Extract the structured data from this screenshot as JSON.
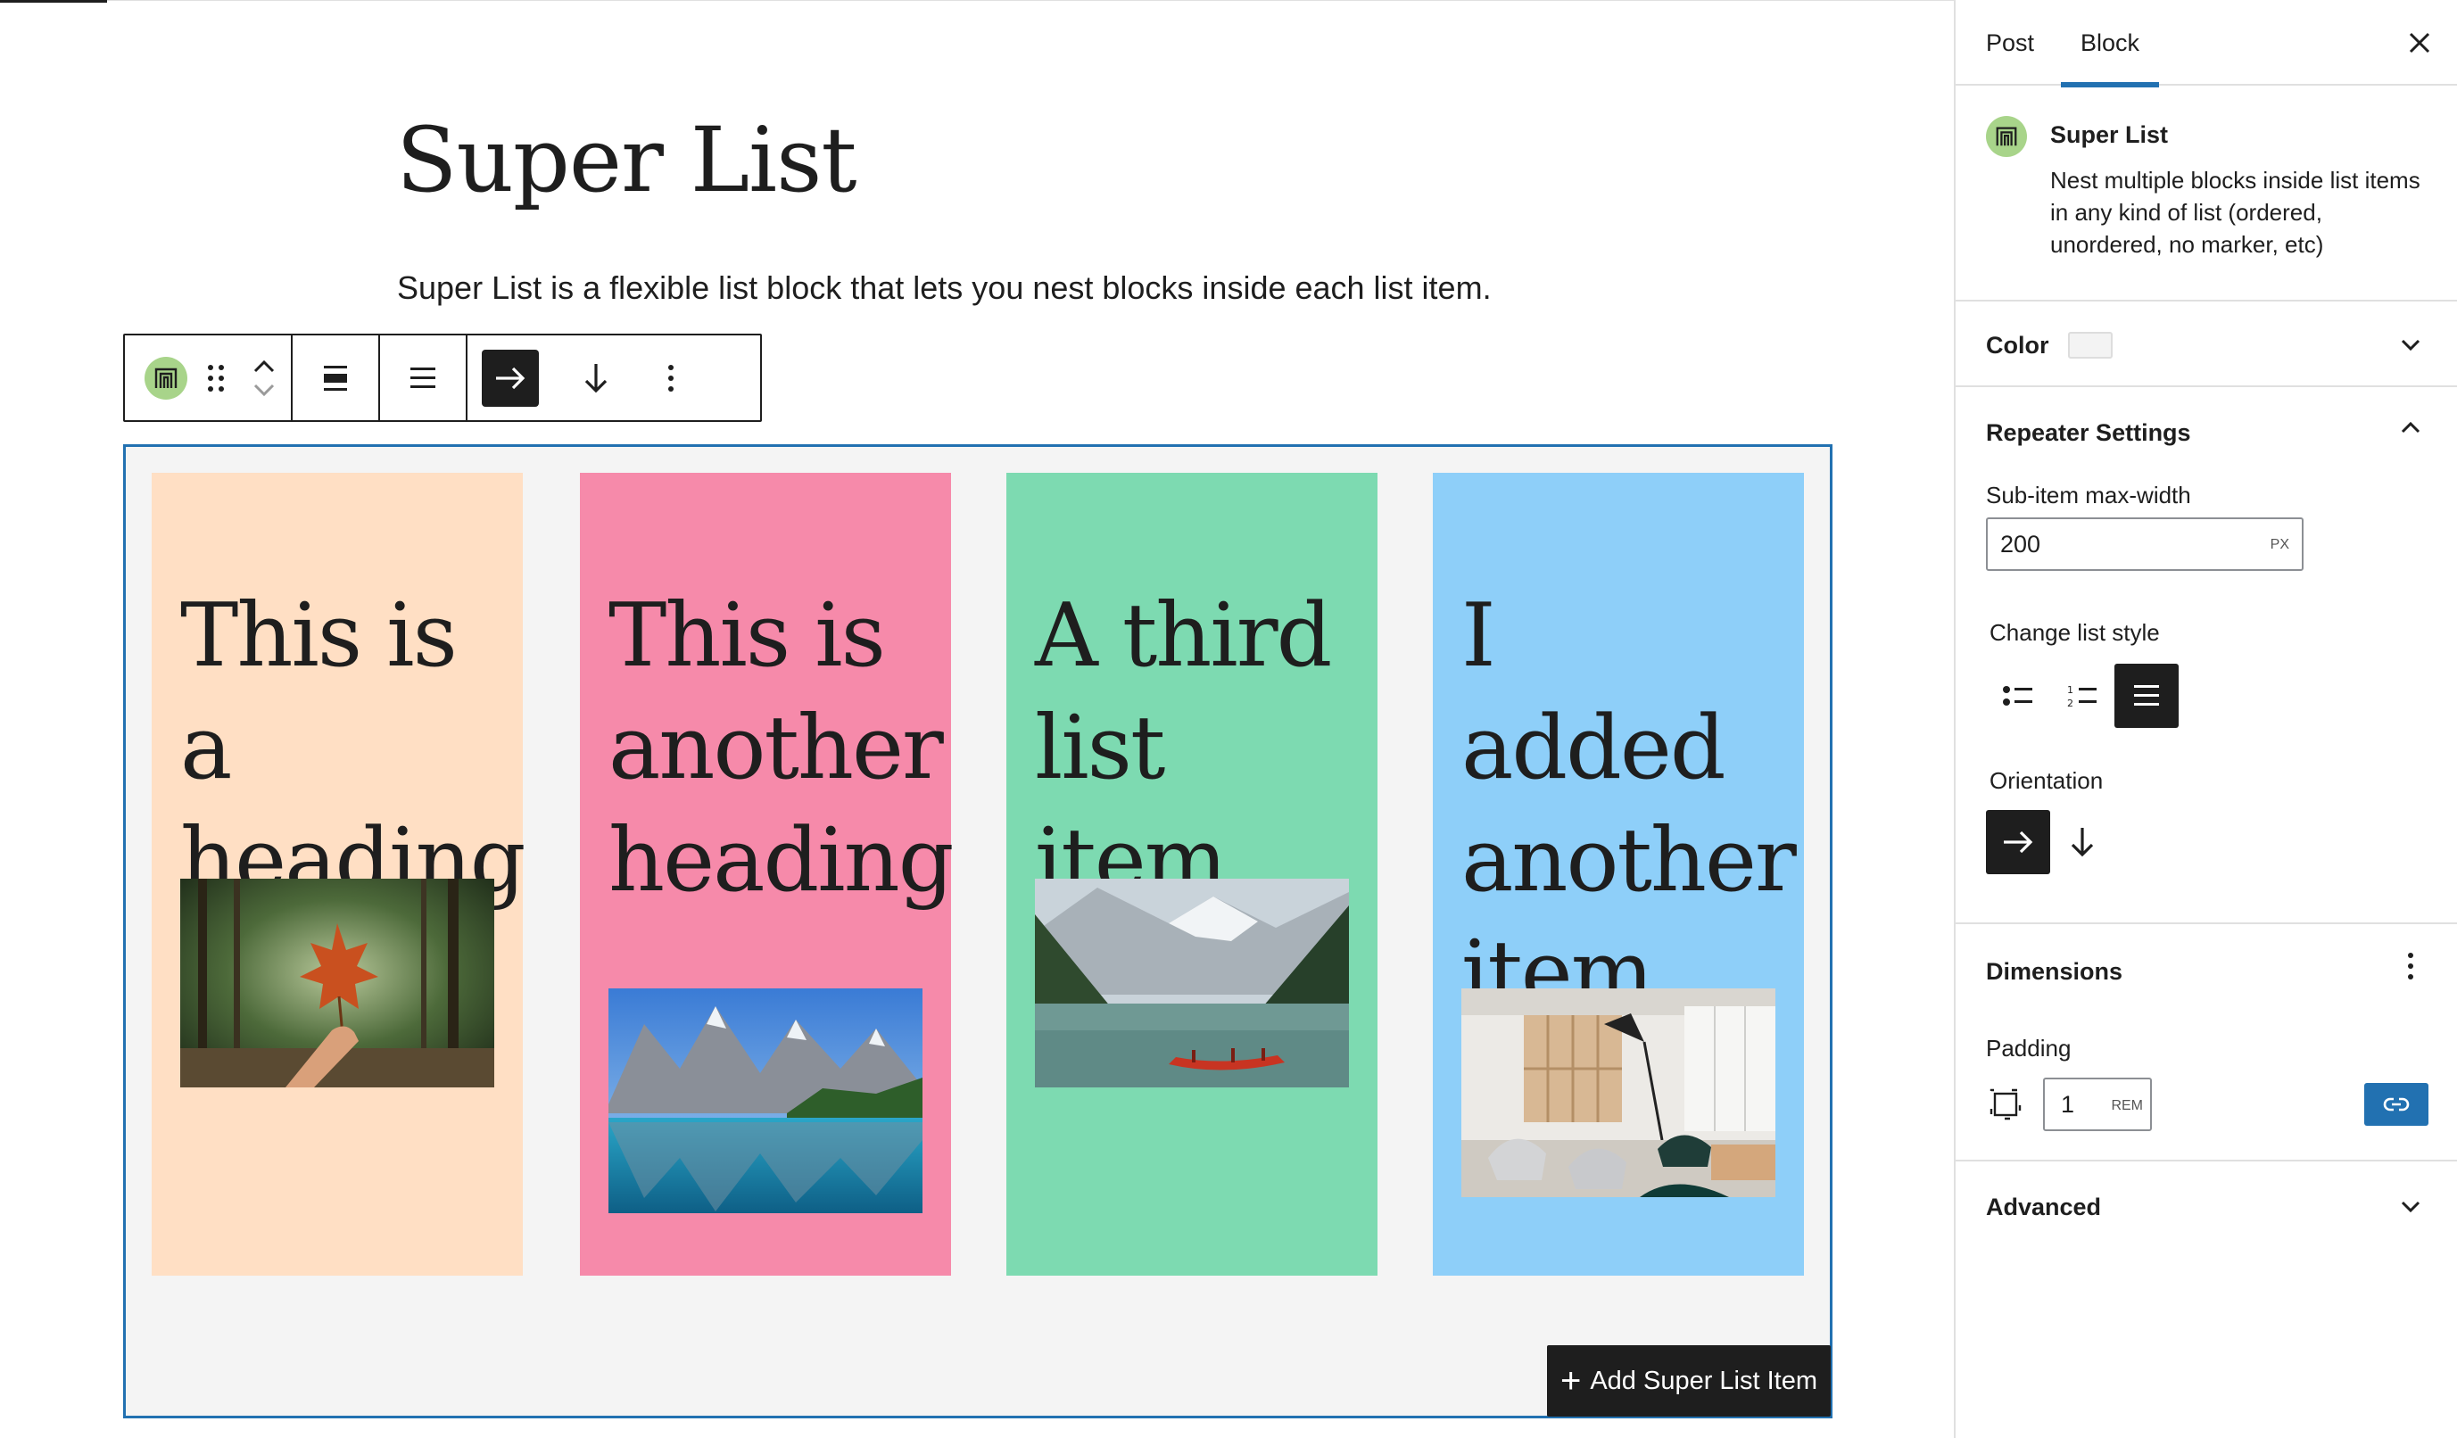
{
  "editor": {
    "title": "Super List",
    "intro": "Super List is a flexible list block that lets you nest blocks inside each list item.",
    "add_item_label": "Add Super List Item"
  },
  "toolbar": {
    "buttons": [
      "block-type",
      "drag",
      "move-up",
      "move-down",
      "justify",
      "list-style",
      "horizontal",
      "vertical",
      "options"
    ],
    "active": "horizontal"
  },
  "cards": [
    {
      "heading": "This is a heading",
      "bg": "#ffdfc4",
      "image": "maple leaf in forest"
    },
    {
      "heading": "This is another heading",
      "bg": "#f68aaa",
      "image": "mountain lake reflection"
    },
    {
      "heading": "A third list item",
      "bg": "#7ddab1",
      "image": "lake with red canoe"
    },
    {
      "heading": "I added another item",
      "bg": "#8ecff9",
      "image": "modern interior room"
    }
  ],
  "sidebar": {
    "tabs": [
      {
        "label": "Post"
      },
      {
        "label": "Block"
      }
    ],
    "active_tab": "Block",
    "block": {
      "name": "Super List",
      "description": "Nest multiple blocks inside list items in any kind of list (ordered, unordered, no marker, etc)"
    },
    "panels": {
      "color": {
        "label": "Color",
        "swatch": "#f3f3f3"
      },
      "repeater": {
        "label": "Repeater Settings",
        "max_width_label": "Sub-item max-width",
        "max_width_value": "200",
        "max_width_unit": "PX",
        "list_style_label": "Change list style",
        "list_style_selected": "none",
        "orientation_label": "Orientation",
        "orientation_selected": "horizontal"
      },
      "dimensions": {
        "label": "Dimensions",
        "padding_label": "Padding",
        "padding_value": "1",
        "padding_unit": "REM"
      },
      "advanced": {
        "label": "Advanced"
      }
    }
  },
  "colors": {
    "accent": "#2271b1",
    "dark": "#1e1e1e",
    "block_icon": "#a8d48a"
  }
}
